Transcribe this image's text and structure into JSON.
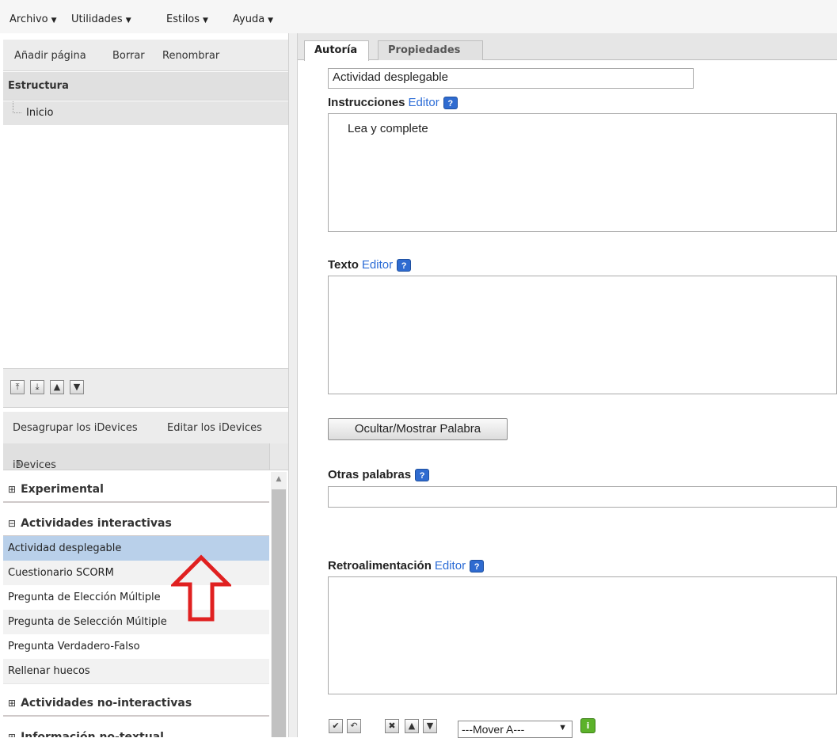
{
  "menubar": {
    "items": [
      {
        "label": "Archivo"
      },
      {
        "label": "Utilidades"
      },
      {
        "label": "Estilos"
      },
      {
        "label": "Ayuda"
      }
    ]
  },
  "outline": {
    "toolbar": {
      "add": "Añadir página",
      "delete": "Borrar",
      "rename": "Renombrar"
    },
    "header": "Estructura",
    "tree": [
      {
        "label": "Inicio"
      }
    ],
    "move_buttons": [
      "move-top",
      "move-bottom",
      "move-up",
      "move-down"
    ]
  },
  "idevices": {
    "toolbar": {
      "ungroup": "Desagrupar los iDevices",
      "edit": "Editar los iDevices"
    },
    "header": "iDevices",
    "sort_indicator": "▲",
    "categories": [
      {
        "label": "Experimental",
        "expanded": false
      },
      {
        "label": "Actividades interactivas",
        "expanded": true
      },
      {
        "label": "Actividades no-interactivas",
        "expanded": false
      },
      {
        "label": "Información no-textual",
        "expanded": false
      }
    ],
    "items": [
      {
        "label": "Actividad desplegable",
        "selected": true
      },
      {
        "label": "Cuestionario SCORM"
      },
      {
        "label": "Pregunta de Elección Múltiple"
      },
      {
        "label": "Pregunta de Selección Múltiple"
      },
      {
        "label": "Pregunta Verdadero-Falso"
      },
      {
        "label": "Rellenar huecos"
      }
    ]
  },
  "tabs": [
    {
      "label": "Autoría",
      "active": true
    },
    {
      "label": "Propiedades",
      "active": false
    }
  ],
  "form": {
    "title_value": "Actividad desplegable",
    "instrucciones_label": "Instrucciones",
    "editor_link": "Editor",
    "help_glyph": "?",
    "instrucciones_value": "Lea y complete",
    "texto_label": "Texto",
    "toggle_button": "Ocultar/Mostrar Palabra",
    "otras_label": "Otras palabras",
    "retro_label": "Retroalimentación",
    "move_select": "---Mover A---",
    "info_glyph": "i",
    "action_icons": [
      "check-icon",
      "undo-icon",
      "delete-icon",
      "up-icon",
      "down-icon"
    ]
  },
  "colors": {
    "selection": "#b9d0ea",
    "link": "#2a6bd6",
    "help_icon": "#2f6bd0",
    "info_icon": "#5cb22a",
    "annotation_arrow": "#e02020"
  }
}
